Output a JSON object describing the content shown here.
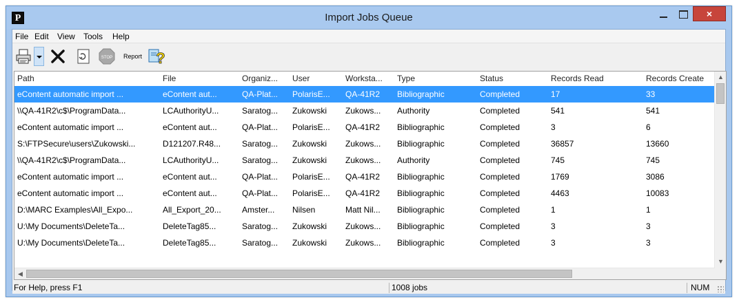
{
  "window": {
    "title": "Import Jobs Queue",
    "app_icon_letter": "P",
    "close_glyph": "×"
  },
  "menu": [
    "File",
    "Edit",
    "View",
    "Tools",
    "Help"
  ],
  "toolbar": {
    "report_label": "Report",
    "icons": [
      "printer-icon",
      "dropdown-arrow-icon",
      "delete-x-icon",
      "refresh-icon",
      "stop-icon",
      "help-icon"
    ]
  },
  "table": {
    "columns": [
      "Path",
      "File",
      "Organiz...",
      "User",
      "Worksta...",
      "Type",
      "Status",
      "Records Read",
      "Records Create"
    ],
    "selected_row": 0,
    "rows": [
      [
        "eContent automatic import ...",
        "eContent aut...",
        "QA-Plat...",
        "PolarisE...",
        "QA-41R2",
        "Bibliographic",
        "Completed",
        "17",
        "33"
      ],
      [
        "\\\\QA-41R2\\c$\\ProgramData...",
        "LCAuthorityU...",
        "Saratog...",
        "Zukowski",
        "Zukows...",
        "Authority",
        "Completed",
        "541",
        "541"
      ],
      [
        "eContent automatic import ...",
        "eContent aut...",
        "QA-Plat...",
        "PolarisE...",
        "QA-41R2",
        "Bibliographic",
        "Completed",
        "3",
        "6"
      ],
      [
        "S:\\FTPSecure\\users\\Zukowski...",
        "D121207.R48...",
        "Saratog...",
        "Zukowski",
        "Zukows...",
        "Bibliographic",
        "Completed",
        "36857",
        "13660"
      ],
      [
        "\\\\QA-41R2\\c$\\ProgramData...",
        "LCAuthorityU...",
        "Saratog...",
        "Zukowski",
        "Zukows...",
        "Authority",
        "Completed",
        "745",
        "745"
      ],
      [
        "eContent automatic import ...",
        "eContent aut...",
        "QA-Plat...",
        "PolarisE...",
        "QA-41R2",
        "Bibliographic",
        "Completed",
        "1769",
        "3086"
      ],
      [
        "eContent automatic import ...",
        "eContent aut...",
        "QA-Plat...",
        "PolarisE...",
        "QA-41R2",
        "Bibliographic",
        "Completed",
        "4463",
        "10083"
      ],
      [
        "D:\\MARC Examples\\All_Expo...",
        "All_Export_20...",
        "Amster...",
        "Nilsen",
        "Matt Nil...",
        "Bibliographic",
        "Completed",
        "1",
        "1"
      ],
      [
        "U:\\My Documents\\DeleteTa...",
        "DeleteTag85...",
        "Saratog...",
        "Zukowski",
        "Zukows...",
        "Bibliographic",
        "Completed",
        "3",
        "3"
      ],
      [
        "U:\\My Documents\\DeleteTa...",
        "DeleteTag85...",
        "Saratog...",
        "Zukowski",
        "Zukows...",
        "Bibliographic",
        "Completed",
        "3",
        "3"
      ]
    ]
  },
  "statusbar": {
    "help_text": "For Help, press F1",
    "jobs_text": "1008 jobs",
    "num_text": "NUM"
  },
  "colors": {
    "titlebar": "#a9c9ef",
    "selection": "#3399ff",
    "close_button": "#c7453b"
  }
}
